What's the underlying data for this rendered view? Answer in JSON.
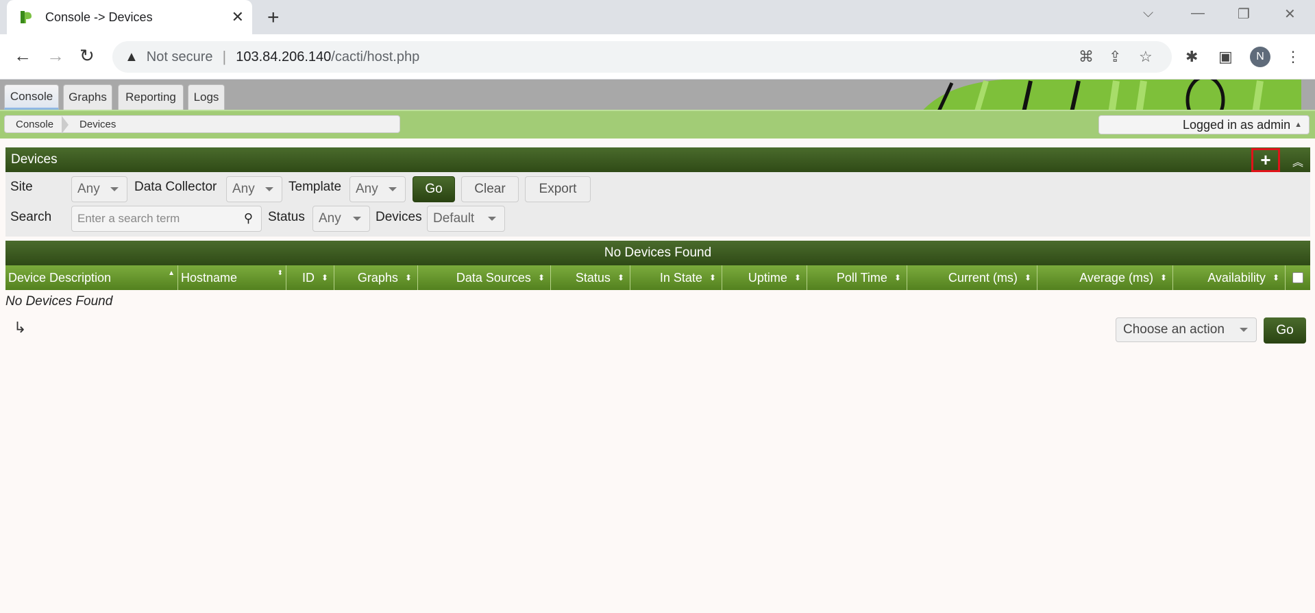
{
  "browser": {
    "tab_title": "Console -> Devices",
    "not_secure": "Not secure",
    "url_host": "103.84.206.140",
    "url_path": "/cacti/host.php",
    "avatar_letter": "N"
  },
  "cacti": {
    "tabs": [
      "Console",
      "Graphs",
      "Reporting",
      "Logs"
    ],
    "breadcrumbs": [
      "Console",
      "Devices"
    ],
    "logged_in": "Logged in as admin"
  },
  "devices": {
    "panel_title": "Devices",
    "filter": {
      "site_label": "Site",
      "site_value": "Any",
      "collector_label": "Data Collector",
      "collector_value": "Any",
      "template_label": "Template",
      "template_value": "Any",
      "go": "Go",
      "clear": "Clear",
      "export": "Export",
      "search_label": "Search",
      "search_placeholder": "Enter a search term",
      "status_label": "Status",
      "status_value": "Any",
      "devices_label": "Devices",
      "devices_value": "Default"
    },
    "table_title": "No Devices Found",
    "columns": [
      "Device Description",
      "Hostname",
      "ID",
      "Graphs",
      "Data Sources",
      "Status",
      "In State",
      "Uptime",
      "Poll Time",
      "Current (ms)",
      "Average (ms)",
      "Availability"
    ],
    "empty_message": "No Devices Found",
    "action_select": "Choose an action",
    "action_go": "Go"
  },
  "colors": {
    "header_dark": "#2f4a16",
    "header_light": "#53811f",
    "crumbbar": "#a2cc76",
    "highlight": "#e0141a"
  }
}
